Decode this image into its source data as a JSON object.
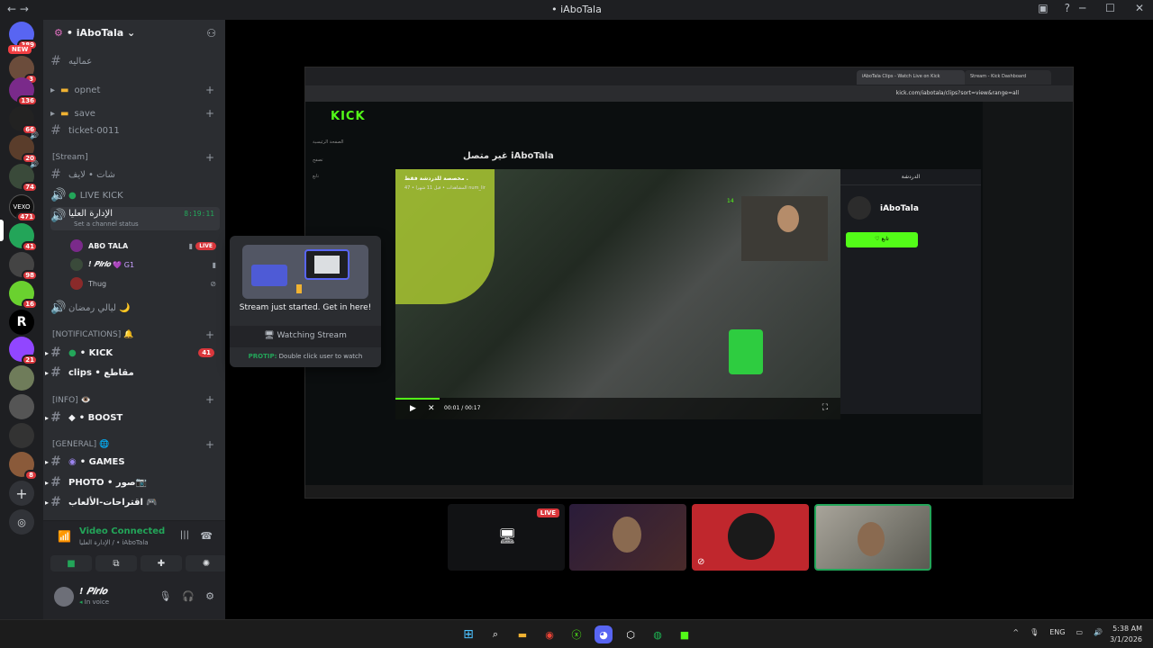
{
  "window": {
    "title": "• iAboTala"
  },
  "servers": {
    "new_label": "NEW",
    "badges": [
      "389",
      "3",
      "136",
      "66",
      "20",
      "74",
      "471",
      "41",
      "98",
      "16",
      "21",
      "8"
    ]
  },
  "guild": {
    "name": "• iAboTala"
  },
  "channels": [
    {
      "type": "text",
      "label": "عماليه"
    },
    {
      "type": "folder",
      "label": "opnet"
    },
    {
      "type": "folder",
      "label": "save"
    },
    {
      "type": "text",
      "label": "ticket-0011"
    }
  ],
  "categories": {
    "stream": "[Stream]",
    "notifications": "[NOTIFICATIONS] 🔔",
    "info": "[INFO] 👁️",
    "general": "[GENERAL] 🌐"
  },
  "stream_channels": [
    {
      "label": "شات • لايف"
    },
    {
      "label": "LIVE KICK"
    }
  ],
  "active_voice": {
    "label": "الإدارة العليا",
    "time": "8:19:11",
    "status_placeholder": "Set a channel status",
    "users": [
      {
        "name": "ABO TALA",
        "live": "LIVE"
      },
      {
        "name": "! 𝑷𝒊𝒓𝒍𝒐",
        "tag": "💜 G1"
      },
      {
        "name": "Thug"
      }
    ]
  },
  "other_voice": {
    "label": "ليالي رمضان 🌙"
  },
  "notif_channels": [
    {
      "label": "• KICK",
      "count": "41"
    },
    {
      "label": "clips • مقاطع"
    }
  ],
  "info_channels": [
    {
      "label": "• BOOST"
    }
  ],
  "general_channels": [
    {
      "label": "• GAMES"
    },
    {
      "label": "PHOTO • صور📷"
    },
    {
      "label": "اقتراحات-الألعاب 🎮"
    }
  ],
  "voice_panel": {
    "status": "Video Connected",
    "location": "الإدارة العليا / • iAboTala"
  },
  "user_panel": {
    "name": "! 𝑷𝒊𝒓𝒍𝒐",
    "status": "In voice"
  },
  "popover": {
    "title": "Stream just started. Get in here!",
    "watch_label": "Watching Stream",
    "protip_label": "PROTIP:",
    "protip_text": "Double click user to watch"
  },
  "shared_screen": {
    "tab1": "iAboTala Clips - Watch Live on Kick",
    "tab2": "Stream - Kick Dashboard",
    "url": "kick.com/iabotala/clips?sort=view&range=all",
    "logo": "KICK",
    "channel_offline": "غير متصل iAboTala",
    "clip_title": "مخصصة للدردشة فقط .",
    "clip_meta": "المشاهدات • قبل 11 شهرا • 47 num_lir",
    "time": "00:01 / 00:17",
    "panel_title": "الدردشة",
    "channel_name": "iAboTala",
    "follow": "♡ تابع",
    "viewers": "14",
    "sidebar": [
      "الصفحة الرئيسية",
      "تصفح",
      "تابع"
    ]
  },
  "tiles": {
    "live_label": "LIVE"
  },
  "taskbar": {
    "lang": "ENG",
    "time": "5:38 AM",
    "date": "3/1/2026"
  }
}
